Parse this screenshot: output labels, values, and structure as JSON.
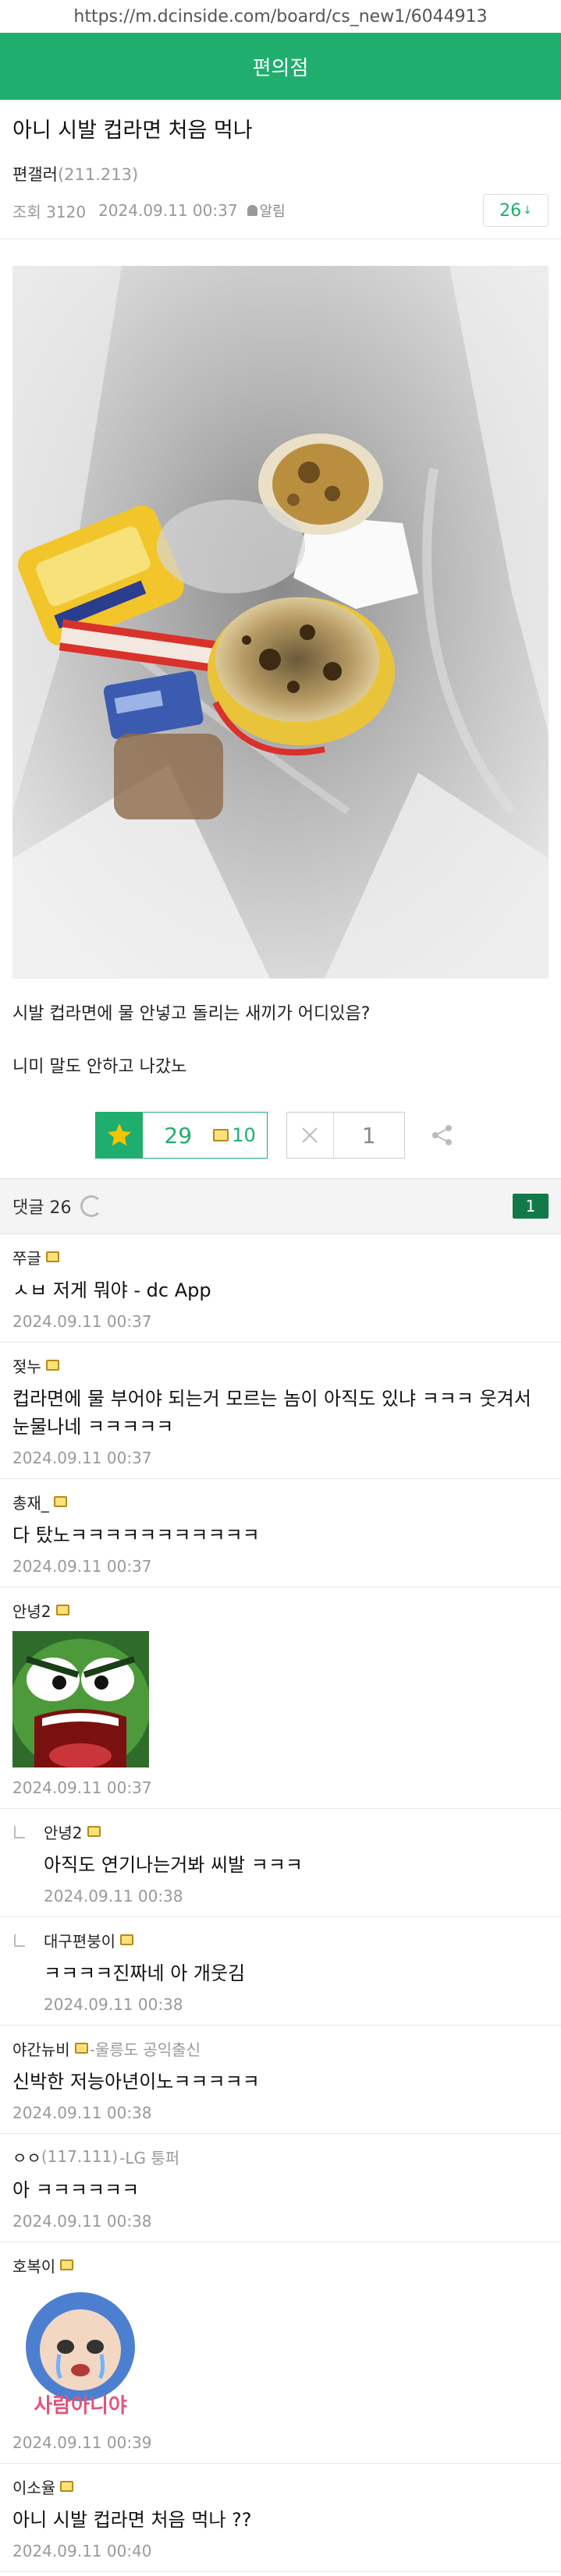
{
  "browser": {
    "url": "https://m.dcinside.com/board/cs_new1/6044913"
  },
  "board": {
    "name": "편의점"
  },
  "post": {
    "title": "아니 시발 컵라면 처음 먹나",
    "writer": "편갤러",
    "writer_ip": "(211.213)",
    "views": "조회 3120",
    "date": "2024.09.11 00:37",
    "alarm_label": "알림",
    "comment_count_btn": "26",
    "image_icon": "photo-of-trash-bag-with-ramen-cup",
    "body_lines": [
      "시발 컵라면에 물 안넣고 돌리는 새끼가 어디있음?",
      "니미 말도 안하고 나갔노"
    ]
  },
  "votes": {
    "recommend": "29",
    "fixed_recommend": "10",
    "nonrecommend": "1"
  },
  "comments_header": {
    "label": "댓글 26",
    "page": "1"
  },
  "colors": {
    "brand_green": "#1fae6e",
    "page_green": "#127a4a"
  },
  "comments": [
    {
      "nick": "쭈글",
      "text": "ㅅㅂ 저게 뭐야 - dc App",
      "date": "2024.09.11 00:37"
    },
    {
      "nick": "젖누",
      "text": "컵라면에 물 부어야 되는거 모르는 놈이 아직도 있냐 ㅋㅋㅋ 웃겨서 눈물나네 ㅋㅋㅋㅋㅋ",
      "date": "2024.09.11 00:37"
    },
    {
      "nick": "총재_",
      "text": "다 탔노ㅋㅋㅋㅋㅋㅋㅋㅋㅋㅋㅋ",
      "date": "2024.09.11 00:37"
    },
    {
      "nick": "안녕2",
      "dccon": "angry-green-frog-dccon",
      "date": "2024.09.11 00:37"
    },
    {
      "nick": "안녕2",
      "text": "아직도 연기나는거봐 씨발 ㅋㅋㅋ",
      "date": "2024.09.11 00:38"
    },
    {
      "nick": "대구편붕이",
      "text": "ㅋㅋㅋㅋ진짜네 아 개웃김",
      "date": "2024.09.11 00:38"
    },
    {
      "nick": "야간뉴비",
      "tag": "-울릉도 공익출신",
      "text": "신박한 저능아년이노ㅋㅋㅋㅋㅋ",
      "date": "2024.09.11 00:38"
    },
    {
      "nick": "ㅇㅇ",
      "ip": "(117.111)",
      "tag": "-LG 퉁퍼",
      "text": "아 ㅋㅋㅋㅋㅋㅋ",
      "date": "2024.09.11 00:38"
    },
    {
      "nick": "호복이",
      "dccon": "crying-character-dccon",
      "dccon_text": "사람아니야",
      "date": "2024.09.11 00:39"
    },
    {
      "nick": "이소율",
      "text": "아니 시발 컵라면 처음 먹나 ??",
      "date": "2024.09.11 00:40"
    }
  ]
}
